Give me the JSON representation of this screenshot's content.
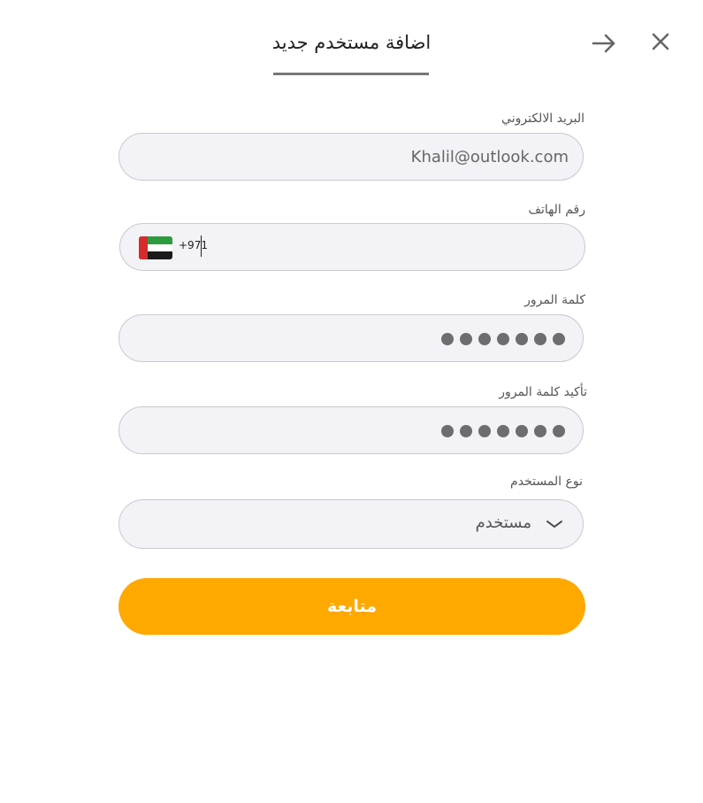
{
  "header": {
    "title": "اضافة مستخدم جديد",
    "close_icon": "close-icon",
    "back_icon": "arrow-right-icon"
  },
  "form": {
    "email": {
      "label": "البريد الالكتروني",
      "value": "Khalil@outlook.com"
    },
    "phone": {
      "label": "رقم الهاتف",
      "country_code": "+971",
      "flag_icon": "uae-flag-icon",
      "value": ""
    },
    "password": {
      "label": "كلمة المرور",
      "masked_length": 7
    },
    "confirm_password": {
      "label": "تأكيد كلمة المرور",
      "masked_length": 7
    },
    "user_type": {
      "label": "نوع المستخدم",
      "selected": "مستخدم",
      "chevron_icon": "chevron-down-icon"
    },
    "submit_label": "متابعة"
  },
  "colors": {
    "accent": "#ffa800",
    "field_bg": "#f2f2f7",
    "field_border": "#c9c9cf",
    "dot": "#6d6d70",
    "underline": "#777777"
  }
}
